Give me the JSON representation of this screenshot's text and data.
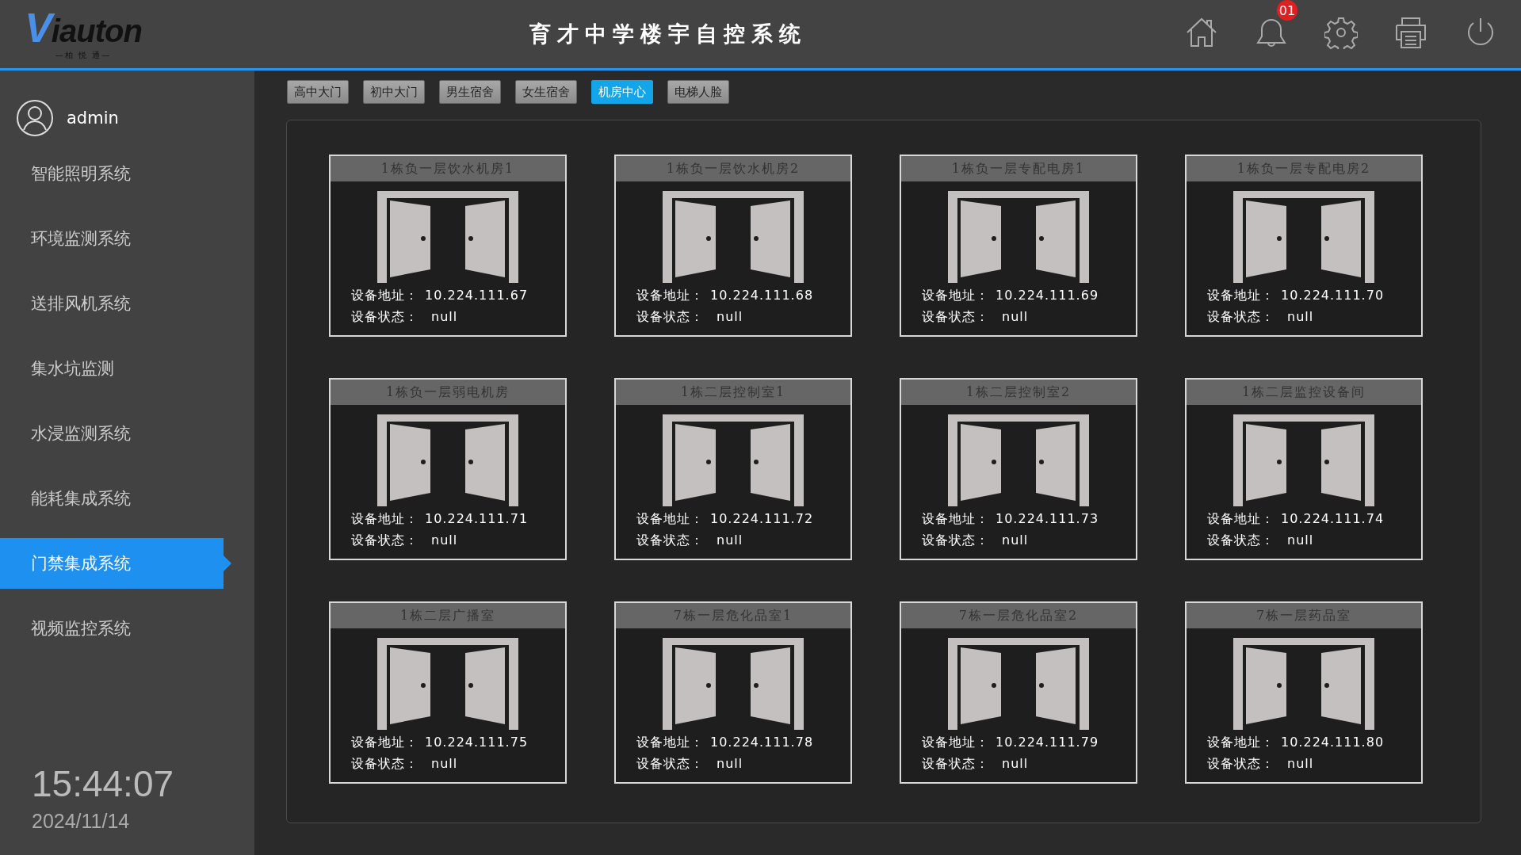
{
  "logo": {
    "name": "Viauton",
    "tagline": "—柏 悦 通—"
  },
  "window": {
    "title": "育才中学楼宇自控系统"
  },
  "header": {
    "notification_badge": "01"
  },
  "user": {
    "name": "admin"
  },
  "sidebar": {
    "items": [
      {
        "label": "智能照明系统",
        "selected": false
      },
      {
        "label": "环境监测系统",
        "selected": false
      },
      {
        "label": "送排风机系统",
        "selected": false
      },
      {
        "label": "集水坑监测",
        "selected": false
      },
      {
        "label": "水浸监测系统",
        "selected": false
      },
      {
        "label": "能耗集成系统",
        "selected": false
      },
      {
        "label": "门禁集成系统",
        "selected": true
      },
      {
        "label": "视频监控系统",
        "selected": false
      }
    ]
  },
  "clock": {
    "time": "15:44:07",
    "date": "2024/11/14"
  },
  "tabs": [
    {
      "label": "高中大门",
      "selected": false
    },
    {
      "label": "初中大门",
      "selected": false
    },
    {
      "label": "男生宿舍",
      "selected": false
    },
    {
      "label": "女生宿舍",
      "selected": false
    },
    {
      "label": "机房中心",
      "selected": true
    },
    {
      "label": "电梯人脸",
      "selected": false
    }
  ],
  "doors": [
    {
      "title": "1栋负一层饮水机房1",
      "address_label": "设备地址：",
      "address": "10.224.111.67",
      "status_label": "设备状态：",
      "status": "null"
    },
    {
      "title": "1栋负一层饮水机房2",
      "address_label": "设备地址：",
      "address": "10.224.111.68",
      "status_label": "设备状态：",
      "status": "null"
    },
    {
      "title": "1栋负一层专配电房1",
      "address_label": "设备地址：",
      "address": "10.224.111.69",
      "status_label": "设备状态：",
      "status": "null"
    },
    {
      "title": "1栋负一层专配电房2",
      "address_label": "设备地址：",
      "address": "10.224.111.70",
      "status_label": "设备状态：",
      "status": "null"
    },
    {
      "title": "1栋负一层弱电机房",
      "address_label": "设备地址：",
      "address": "10.224.111.71",
      "status_label": "设备状态：",
      "status": "null"
    },
    {
      "title": "1栋二层控制室1",
      "address_label": "设备地址：",
      "address": "10.224.111.72",
      "status_label": "设备状态：",
      "status": "null"
    },
    {
      "title": "1栋二层控制室2",
      "address_label": "设备地址：",
      "address": "10.224.111.73",
      "status_label": "设备状态：",
      "status": "null"
    },
    {
      "title": "1栋二层监控设备间",
      "address_label": "设备地址：",
      "address": "10.224.111.74",
      "status_label": "设备状态：",
      "status": "null"
    },
    {
      "title": "1栋二层广播室",
      "address_label": "设备地址：",
      "address": "10.224.111.75",
      "status_label": "设备状态：",
      "status": "null"
    },
    {
      "title": "7栋一层危化品室1",
      "address_label": "设备地址：",
      "address": "10.224.111.78",
      "status_label": "设备状态：",
      "status": "null"
    },
    {
      "title": "7栋一层危化品室2",
      "address_label": "设备地址：",
      "address": "10.224.111.79",
      "status_label": "设备状态：",
      "status": "null"
    },
    {
      "title": "7栋一层药品室",
      "address_label": "设备地址：",
      "address": "10.224.111.80",
      "status_label": "设备状态：",
      "status": "null"
    }
  ]
}
